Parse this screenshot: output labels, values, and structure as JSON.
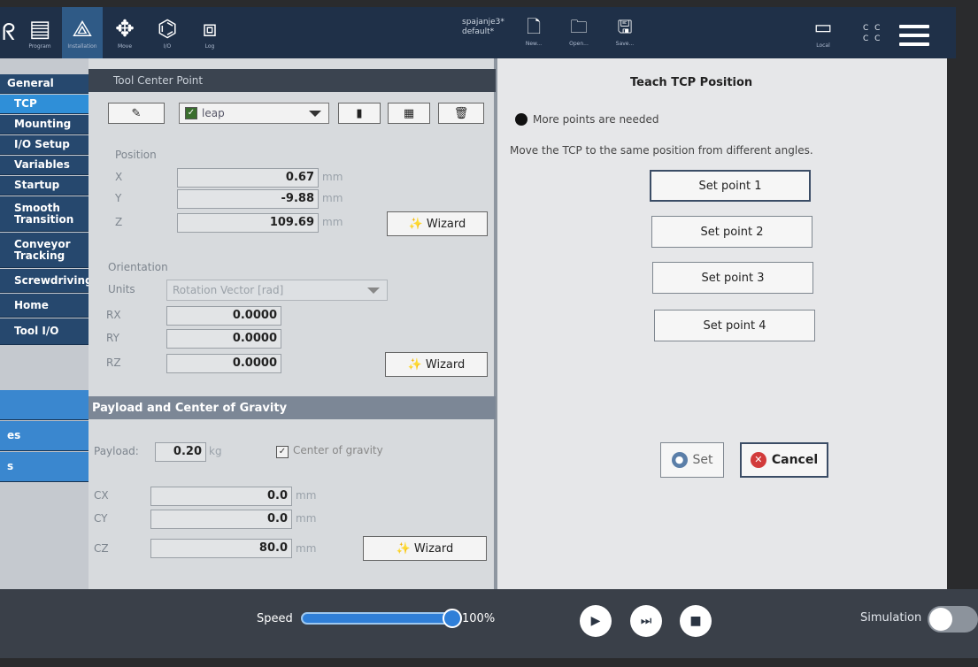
{
  "topbar": {
    "tabs": [
      {
        "label": "",
        "icon": "robot-partial-icon"
      },
      {
        "label": "Program",
        "icon": "program-icon"
      },
      {
        "label": "Installation",
        "icon": "installation-icon"
      },
      {
        "label": "Move",
        "icon": "move-icon"
      },
      {
        "label": "I/O",
        "icon": "io-icon"
      },
      {
        "label": "Log",
        "icon": "log-icon"
      }
    ],
    "file_line1": "spajanje3*",
    "file_line2": "default*",
    "new_label": "New...",
    "open_label": "Open...",
    "save_label": "Save...",
    "local_label": "Local",
    "cc_line1": "C C",
    "cc_line2": "C C"
  },
  "leftnav": {
    "items": [
      {
        "label": "General"
      },
      {
        "label": "TCP"
      },
      {
        "label": "Mounting"
      },
      {
        "label": "I/O Setup"
      },
      {
        "label": "Variables"
      },
      {
        "label": "Startup"
      },
      {
        "label": "Smooth Transition"
      },
      {
        "label": "Conveyor Tracking"
      },
      {
        "label": "Screwdriving"
      },
      {
        "label": "Home"
      },
      {
        "label": "Tool I/O"
      },
      {
        "label": ""
      },
      {
        "label": "es"
      },
      {
        "label": "s"
      }
    ]
  },
  "tcp": {
    "header": "Tool Center Point",
    "tcp_name": "leap",
    "position_label": "Position",
    "x_label": "X",
    "x_value": "0.67",
    "y_label": "Y",
    "y_value": "-9.88",
    "z_label": "Z",
    "z_value": "109.69",
    "unit_mm": "mm",
    "wizard_label": "Wizard",
    "orientation_label": "Orientation",
    "units_label": "Units",
    "units_value": "Rotation Vector [rad]",
    "rx_label": "RX",
    "rx_value": "0.0000",
    "ry_label": "RY",
    "ry_value": "0.0000",
    "rz_label": "RZ",
    "rz_value": "0.0000"
  },
  "payload": {
    "header": "Payload and Center of Gravity",
    "payload_label": "Payload:",
    "payload_value": "0.20",
    "payload_unit": "kg",
    "cog_label": "Center of gravity",
    "cx_label": "CX",
    "cx_value": "0.0",
    "cy_label": "CY",
    "cy_value": "0.0",
    "cz_label": "CZ",
    "cz_value": "80.0",
    "unit_mm": "mm",
    "wizard_label": "Wizard"
  },
  "teach": {
    "title": "Teach TCP Position",
    "status": "More points are needed",
    "instruction": "Move the TCP to the same position from different angles.",
    "points": [
      "Set point 1",
      "Set point 2",
      "Set point 3",
      "Set point 4"
    ],
    "set_label": "Set",
    "cancel_label": "Cancel"
  },
  "bottom": {
    "speed_label": "Speed",
    "speed_value": "100%",
    "speed_fraction": 1.0,
    "simulation_label": "Simulation"
  },
  "colors": {
    "accent": "#2f7fd8",
    "nav_bg": "#26486e",
    "topbar": "#1f3048",
    "cancel_red": "#d23b3b"
  }
}
